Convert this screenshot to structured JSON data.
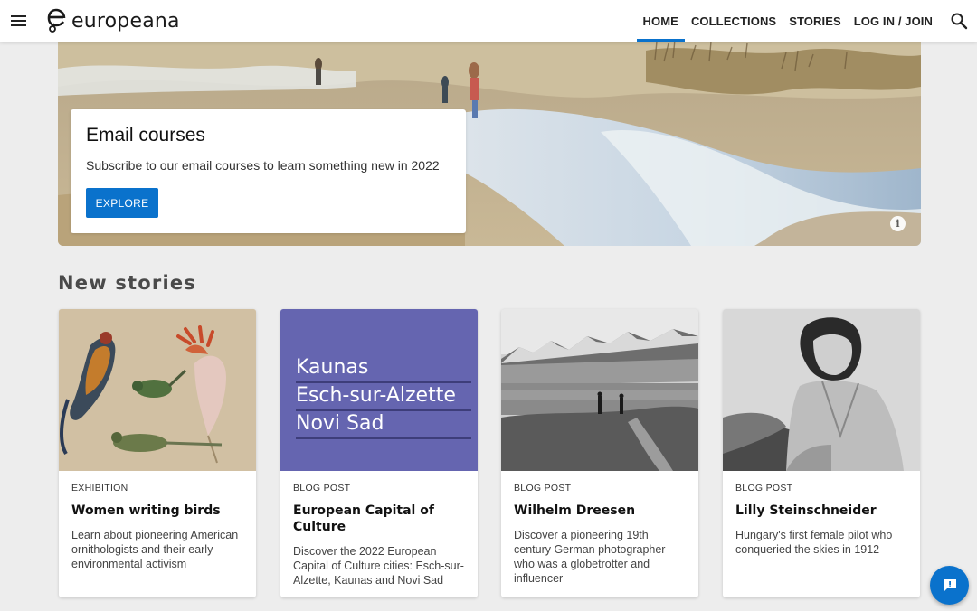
{
  "header": {
    "logo_text": "europeana",
    "nav": [
      {
        "label": "HOME",
        "active": true
      },
      {
        "label": "COLLECTIONS",
        "active": false
      },
      {
        "label": "STORIES",
        "active": false
      },
      {
        "label": "LOG IN / JOIN",
        "active": false
      }
    ]
  },
  "hero": {
    "title": "Email courses",
    "subtitle": "Subscribe to our email courses to learn something new in 2022",
    "button_label": "EXPLORE"
  },
  "section": {
    "title": "New stories"
  },
  "cards": [
    {
      "type": "EXHIBITION",
      "title": "Women writing birds",
      "description": "Learn about pioneering American ornithologists and their early environmental activism"
    },
    {
      "type": "BLOG POST",
      "title": "European Capital of Culture",
      "description": "Discover the 2022 European Capital of Culture cities: Esch-sur-Alzette, Kaunas and Novi Sad",
      "image_lines": [
        "Kaunas",
        "Esch-sur-Alzette",
        "Novi Sad"
      ],
      "image_color": "#6565b0"
    },
    {
      "type": "BLOG POST",
      "title": "Wilhelm Dreesen",
      "description": "Discover a pioneering 19th century German photographer who was a globetrotter and influencer"
    },
    {
      "type": "BLOG POST",
      "title": "Lilly Steinschneider",
      "description": "Hungary's first female pilot who conqueried the skies in 1912"
    }
  ],
  "colors": {
    "accent": "#0a72cc",
    "background": "#ededed"
  }
}
